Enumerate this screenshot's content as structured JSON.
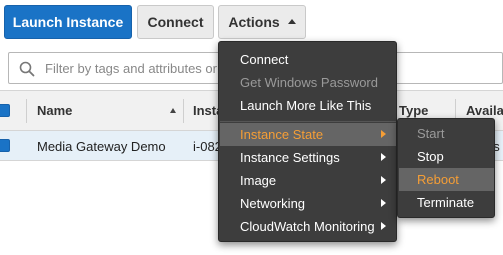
{
  "toolbar": {
    "launch_label": "Launch Instance",
    "connect_label": "Connect",
    "actions_label": "Actions"
  },
  "search": {
    "placeholder": "Filter by tags and attributes or"
  },
  "table": {
    "columns": [
      "Name",
      "Insta",
      "Type",
      "Availa"
    ],
    "rows": [
      {
        "name": "Media Gateway Demo",
        "instance_id": "i-082",
        "extra": "es"
      }
    ]
  },
  "actions_menu": {
    "items": [
      {
        "label": "Connect",
        "state": "enabled"
      },
      {
        "label": "Get Windows Password",
        "state": "disabled"
      },
      {
        "label": "Launch More Like This",
        "state": "enabled"
      },
      {
        "label": "Instance State",
        "state": "active",
        "submenu": true
      },
      {
        "label": "Instance Settings",
        "state": "enabled",
        "submenu": true
      },
      {
        "label": "Image",
        "state": "enabled",
        "submenu": true
      },
      {
        "label": "Networking",
        "state": "enabled",
        "submenu": true
      },
      {
        "label": "CloudWatch Monitoring",
        "state": "enabled",
        "submenu": true
      }
    ]
  },
  "instance_state_submenu": {
    "items": [
      {
        "label": "Start",
        "state": "disabled"
      },
      {
        "label": "Stop",
        "state": "enabled"
      },
      {
        "label": "Reboot",
        "state": "highlighted"
      },
      {
        "label": "Terminate",
        "state": "enabled"
      }
    ]
  },
  "colors": {
    "primary_button": "#1a73c6",
    "menu_background": "#3d3d3d",
    "menu_active_background": "#656565",
    "menu_accent_text": "#f59e36",
    "selected_row": "#e6f0f8"
  }
}
